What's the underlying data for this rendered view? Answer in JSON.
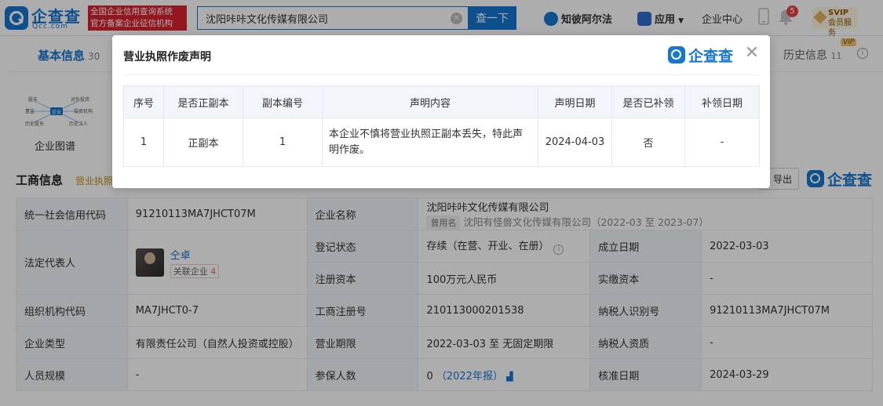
{
  "header": {
    "logo_text": "企查查",
    "logo_sub": "Qcc.com",
    "slogan_line1": "全国企业信用查询系统",
    "slogan_line2": "官方备案企业征信机构",
    "search_value": "沈阳咔咔文化传媒有限公司",
    "search_button": "查一下",
    "zhiqi": "知彼阿尔法",
    "app": "应用",
    "enterprise_center": "企业中心",
    "notif_count": "5",
    "svip_line1": "SVIP",
    "svip_line2": "会员服务"
  },
  "tabs": {
    "basic_info": "基本信息",
    "basic_count": "30",
    "history": "历史信息",
    "history_count": "11",
    "vip": "VIP"
  },
  "graph": {
    "label": "企业图谱",
    "n1": "股东",
    "n2": "对外投资",
    "n3": "董监",
    "n4": "企业",
    "n5": "投资机构",
    "n6": "历史股东",
    "n7": "历史法人"
  },
  "section": {
    "title": "工商信息",
    "subtitle": "营业执照",
    "export": "导出",
    "logo": "企查查"
  },
  "info": {
    "credit_code_label": "统一社会信用代码",
    "credit_code": "91210113MA7JHCT07M",
    "company_name_label": "企业名称",
    "company_name": "沈阳咔咔文化传媒有限公司",
    "used_name_tag": "曾用名",
    "used_name": "沈阳有怪兽文化传媒有限公司（2022-03 至 2023-07）",
    "legal_rep_label": "法定代表人",
    "legal_rep": "仝卓",
    "related_label": "关联企业",
    "related_count": "4",
    "reg_status_label": "登记状态",
    "reg_status": "存续（在营、开业、在册）",
    "established_label": "成立日期",
    "established": "2022-03-03",
    "reg_capital_label": "注册资本",
    "reg_capital": "100万元人民币",
    "paid_capital_label": "实缴资本",
    "paid_capital": "-",
    "org_code_label": "组织机构代码",
    "org_code": "MA7JHCT0-7",
    "biz_reg_label": "工商注册号",
    "biz_reg": "210113000201538",
    "taxpayer_id_label": "纳税人识别号",
    "taxpayer_id": "91210113MA7JHCT07M",
    "type_label": "企业类型",
    "type": "有限责任公司（自然人投资或控股）",
    "term_label": "营业期限",
    "term": "2022-03-03 至 无固定期限",
    "taxpayer_qual_label": "纳税人资质",
    "taxpayer_qual": "-",
    "staff_label": "人员规模",
    "staff": "-",
    "insured_label": "参保人数",
    "insured": "0",
    "insured_year": "（2022年报）",
    "approved_label": "核准日期",
    "approved": "2024-03-29"
  },
  "modal": {
    "title": "营业执照作废声明",
    "logo": "企查查",
    "columns": [
      "序号",
      "是否正副本",
      "副本编号",
      "声明内容",
      "声明日期",
      "是否已补领",
      "补领日期"
    ],
    "rows": [
      {
        "index": "1",
        "copy_type": "正副本",
        "copy_no": "1",
        "content": "本企业不慎将营业执照正副本丢失，特此声明作废。",
        "date": "2024-04-03",
        "reissued": "否",
        "reissue_date": "-"
      }
    ]
  },
  "colors": {
    "brand": "#1677d2",
    "slogan_bg": "#d9232e",
    "label_bg": "#f2f6fb"
  }
}
